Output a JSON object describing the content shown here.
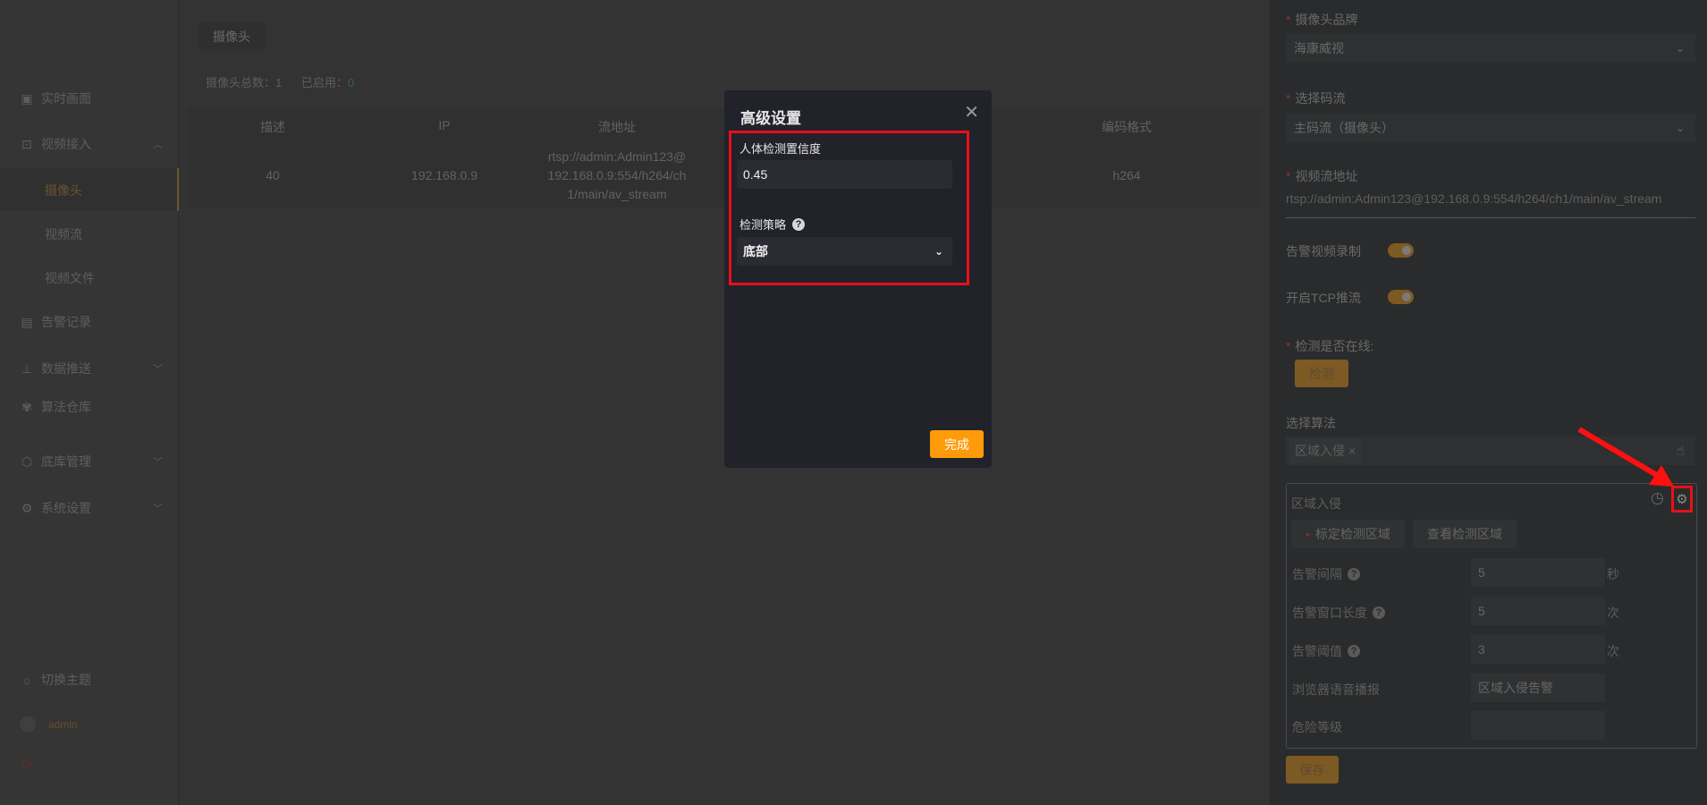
{
  "sidebar": {
    "items": [
      {
        "label": "实时画面",
        "icon": "monitor-chart-icon"
      },
      {
        "label": "视频接入",
        "icon": "video-input-icon"
      },
      {
        "label": "告警记录",
        "icon": "list-icon"
      },
      {
        "label": "数据推送",
        "icon": "push-icon"
      },
      {
        "label": "算法仓库",
        "icon": "algorithm-icon"
      },
      {
        "label": "底库管理",
        "icon": "box-icon"
      },
      {
        "label": "系统设置",
        "icon": "gear-icon"
      }
    ],
    "sub_items": [
      "摄像头",
      "视频流",
      "视频文件"
    ],
    "theme_label": "切换主题",
    "user": "admin"
  },
  "main": {
    "tab": "摄像头",
    "stats": {
      "total_label": "摄像头总数：",
      "total": "1",
      "enabled_label": "已启用：",
      "enabled": "0"
    },
    "columns": [
      "描述",
      "IP",
      "流地址",
      "编码格式"
    ],
    "rows": [
      {
        "desc": "40",
        "ip": "192.168.0.9",
        "stream_1": "rtsp://admin:Admin123@",
        "stream_2": "192.168.0.9:554/h264/ch",
        "stream_3": "1/main/av_stream",
        "codec": "h264"
      }
    ]
  },
  "modal": {
    "title": "高级设置",
    "confidence_label": "人体检测置信度",
    "confidence_value": "0.45",
    "strategy_label": "检测策略",
    "strategy_value": "底部",
    "done_label": "完成"
  },
  "panel": {
    "brand_label": "摄像头品牌",
    "brand_value": "海康威视",
    "stream_label": "选择码流",
    "stream_value": "主码流（摄像头）",
    "url_label": "视频流地址",
    "url_value": "rtsp://admin:Admin123@192.168.0.9:554/h264/ch1/main/av_stream",
    "record_label": "告警视频录制",
    "record_on": true,
    "tcp_label": "开启TCP推流",
    "tcp_on": true,
    "online_label": "检测是否在线:",
    "check_label": "检测",
    "algo_label": "选择算法",
    "algo_tag": "区域入侵",
    "card": {
      "title": "区域入侵",
      "mark_area": "标定检测区域",
      "view_area": "查看检测区域",
      "interval_label": "告警间隔",
      "interval_value": "5",
      "interval_unit": "秒",
      "window_label": "告警窗口长度",
      "window_value": "5",
      "window_unit": "次",
      "threshold_label": "告警阈值",
      "threshold_value": "3",
      "threshold_unit": "次",
      "speech_label": "浏览器语音播报",
      "speech_value": "区域入侵告警",
      "danger_label": "危险等级",
      "danger_value": ""
    },
    "save_label": "保存"
  },
  "colors": {
    "accent": "#ff9a0a",
    "highlight": "#e8101a"
  }
}
